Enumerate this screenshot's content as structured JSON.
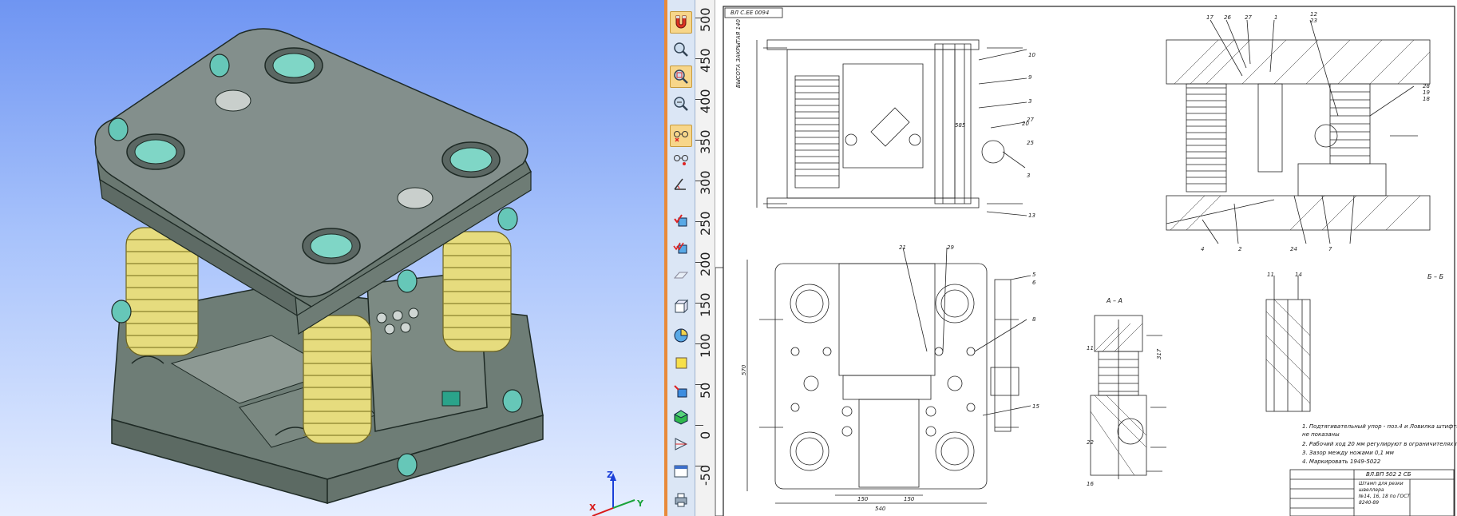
{
  "viewport": {
    "background_top": "#6f95f2",
    "background_bottom": "#e6eeff",
    "model_colors": {
      "body": "#7b8a82",
      "top_face": "#838f8c",
      "spring": "#e6dc7e",
      "bushing": "#7fd6c6"
    },
    "axes": {
      "z": "Z",
      "y": "Y",
      "x": "X"
    }
  },
  "toolbar": {
    "tools": [
      {
        "name": "magnet-icon",
        "icon": "magnet"
      },
      {
        "name": "zoom-window-icon",
        "icon": "zoom-window"
      },
      {
        "name": "zoom-region-icon",
        "icon": "zoom-region"
      },
      {
        "name": "zoom-in-icon",
        "icon": "zoom-in"
      },
      {
        "name": "snap-cancel-icon",
        "icon": "glasses-cross"
      },
      {
        "name": "snap-point-icon",
        "icon": "glasses-point"
      },
      {
        "name": "snap-angle-icon",
        "icon": "glasses-angle"
      },
      {
        "name": "constraint-check-icon",
        "icon": "check-cube"
      },
      {
        "name": "constraint-double-icon",
        "icon": "check-cube-double"
      },
      {
        "name": "plane-icon",
        "icon": "plane"
      },
      {
        "name": "cube-view-icon",
        "icon": "cube-view"
      },
      {
        "name": "section-view-icon",
        "icon": "circle-section"
      },
      {
        "name": "fill-color-icon",
        "icon": "yellow-square"
      },
      {
        "name": "shade-icon",
        "icon": "blue-cube"
      },
      {
        "name": "render-icon",
        "icon": "green-cube"
      },
      {
        "name": "projection-icon",
        "icon": "prism"
      },
      {
        "name": "window-icon",
        "icon": "window"
      },
      {
        "name": "print-icon",
        "icon": "printer"
      }
    ]
  },
  "ruler": {
    "labels": [
      "500",
      "450",
      "400",
      "350",
      "300",
      "250",
      "200",
      "150",
      "100",
      "50",
      "0",
      "-50"
    ]
  },
  "drawing": {
    "stamp_text": "ВЛ С.ЕЕ 0094",
    "section_aa": "А – А",
    "section_bb": "Б – Б",
    "leader_labels": [
      "17",
      "26",
      "27",
      "1",
      "12",
      "23",
      "10",
      "9",
      "3",
      "27",
      "25",
      "3",
      "13",
      "4",
      "2",
      "24",
      "7",
      "5",
      "6",
      "8",
      "15",
      "11",
      "22",
      "16",
      "21",
      "29",
      "11",
      "14",
      "28",
      "19",
      "18",
      "20"
    ],
    "dim_labels": [
      "ВЫСОТА ЗАКРЫТАЯ 140",
      "585",
      "570",
      "150",
      "150",
      "540",
      "317"
    ],
    "notes": [
      "1. Подтягивательный упор - поз.4 и Ловилка штифта - поз.5 устано-",
      "не показаны",
      "2. Рабочий ход 20 мм регулируют в ограничителях поз.12",
      "3. Зазор между ножами 0,1 мм",
      "4. Маркировать 1949-5022"
    ],
    "title_block": {
      "code": "ВЛ.ВП 502 2 СБ",
      "name_line1": "Штамп для резки",
      "name_line2": "швеллера",
      "name_line3": "№14, 16, 18 по ГОСТ",
      "name_line4": "8240-89"
    }
  }
}
